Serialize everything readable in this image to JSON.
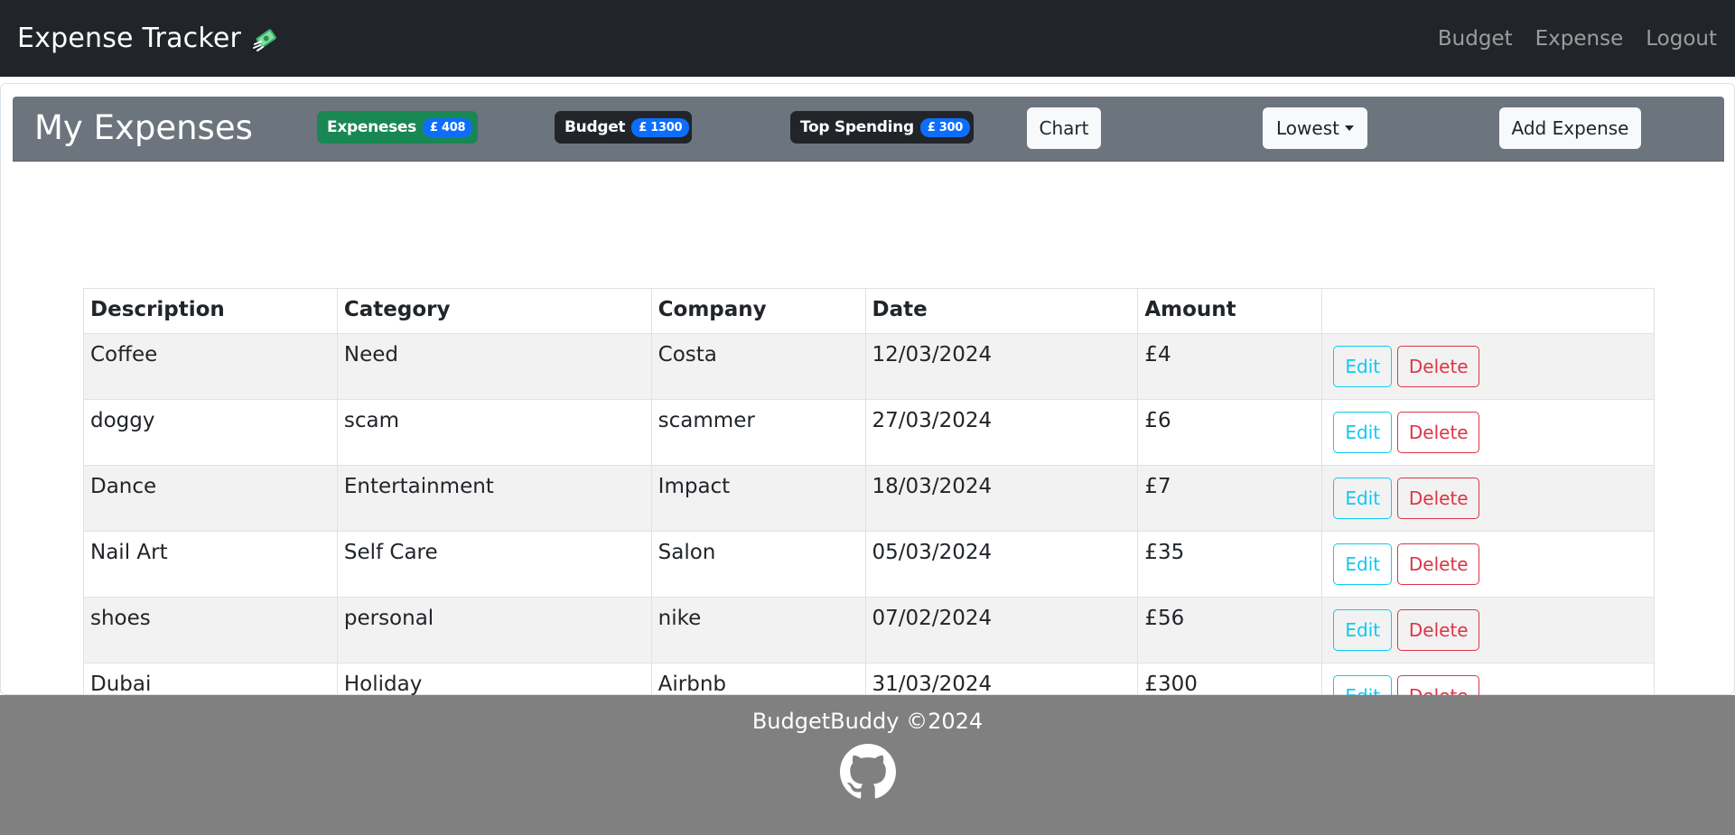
{
  "navbar": {
    "brand": "Expense Tracker",
    "brand_icon": "money-with-wings-icon",
    "links": [
      "Budget",
      "Expense",
      "Logout"
    ]
  },
  "header": {
    "title": "My Expenses",
    "expenses_label": "Expeneses",
    "expenses_value": "£ 408",
    "budget_label": "Budget",
    "budget_value": "£ 1300",
    "top_label": "Top Spending",
    "top_value": "£ 300",
    "chart_button": "Chart",
    "sort_button": "Lowest",
    "add_button": "Add Expense"
  },
  "table": {
    "columns": [
      "Description",
      "Category",
      "Company",
      "Date",
      "Amount",
      ""
    ],
    "rows": [
      {
        "description": "Coffee",
        "category": "Need",
        "company": "Costa",
        "date": "12/03/2024",
        "amount": "£4"
      },
      {
        "description": "doggy",
        "category": "scam",
        "company": "scammer",
        "date": "27/03/2024",
        "amount": "£6"
      },
      {
        "description": "Dance",
        "category": "Entertainment",
        "company": "Impact",
        "date": "18/03/2024",
        "amount": "£7"
      },
      {
        "description": "Nail Art",
        "category": "Self Care",
        "company": "Salon",
        "date": "05/03/2024",
        "amount": "£35"
      },
      {
        "description": "shoes",
        "category": "personal",
        "company": "nike",
        "date": "07/02/2024",
        "amount": "£56"
      },
      {
        "description": "Dubai",
        "category": "Holiday",
        "company": "Airbnb",
        "date": "31/03/2024",
        "amount": "£300"
      }
    ],
    "edit_label": "Edit",
    "delete_label": "Delete"
  },
  "footer": {
    "text": "BudgetBuddy ©2024",
    "icon": "github-icon"
  },
  "colors": {
    "navbar_bg": "#212529",
    "header_bg": "#6c757d",
    "green_badge": "#198754",
    "blue_badge": "#0d6efd",
    "edit": "#0dcaf0",
    "delete": "#dc3545",
    "footer_bg": "#808080"
  }
}
